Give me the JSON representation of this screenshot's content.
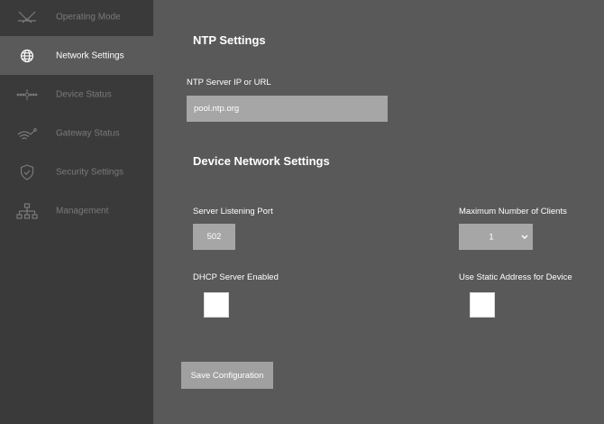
{
  "sidebar": {
    "items": [
      {
        "label": "Operating Mode",
        "icon": "operating-mode-icon",
        "active": false
      },
      {
        "label": "Network Settings",
        "icon": "globe-icon",
        "active": true
      },
      {
        "label": "Device Status",
        "icon": "device-status-icon",
        "active": false
      },
      {
        "label": "Gateway Status",
        "icon": "gateway-icon",
        "active": false
      },
      {
        "label": "Security Settings",
        "icon": "shield-icon",
        "active": false
      },
      {
        "label": "Management",
        "icon": "management-icon",
        "active": false
      }
    ]
  },
  "ntp": {
    "title": "NTP Settings",
    "server_label": "NTP Server IP or URL",
    "server_value": "pool.ntp.org"
  },
  "device_network": {
    "title": "Device Network Settings",
    "port_label": "Server Listening Port",
    "port_value": "502",
    "max_clients_label": "Maximum Number of Clients",
    "max_clients_value": "1",
    "dhcp_label": "DHCP Server Enabled",
    "dhcp_checked": false,
    "static_label": "Use Static Address for Device",
    "static_checked": false
  },
  "actions": {
    "save_label": "Save Configuration"
  },
  "colors": {
    "sidebar_bg": "#3a3a3a",
    "active_item_bg": "#5a5a5a",
    "main_bg": "#595959",
    "input_bg": "#a6a6a6",
    "inactive_text": "#7a7a7a"
  }
}
